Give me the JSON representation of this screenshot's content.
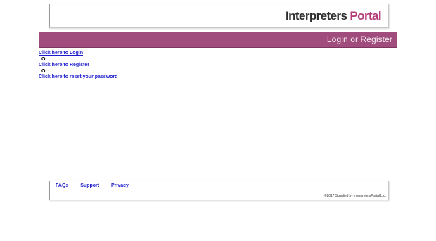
{
  "header": {
    "logo_part1": "Interpreters",
    "logo_part2": "Portal"
  },
  "banner": {
    "title": "Login or Register"
  },
  "auth": {
    "login_link": "Click here to Login",
    "or_1": "Or",
    "register_link": "Click here to Register",
    "or_2": "Or",
    "reset_link": "Click here to reset your password"
  },
  "footer": {
    "links": [
      "FAQs",
      "Support",
      "Privacy"
    ],
    "copyright": "©2017 Supplied by InterpretersPortal Ltd."
  },
  "colors": {
    "brand_magenta": "#b23d79",
    "banner_bg": "#a04d7e",
    "link": "#1a1acc"
  }
}
